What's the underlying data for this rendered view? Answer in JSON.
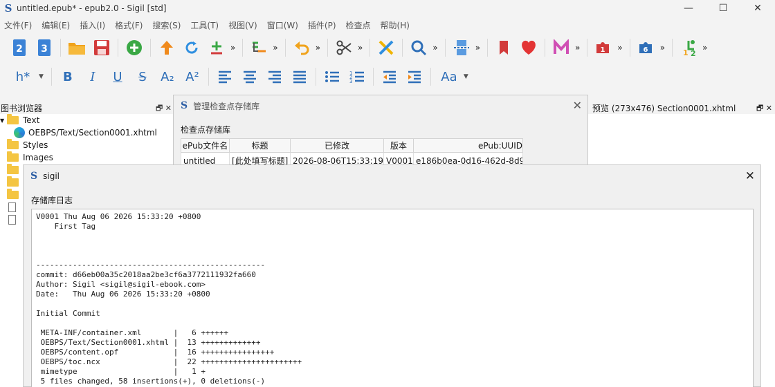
{
  "window": {
    "title": "untitled.epub* - epub2.0 - Sigil [std]",
    "logo": "S",
    "controls": [
      "—",
      "☐",
      "✕"
    ]
  },
  "menu": [
    "文件(F)",
    "编辑(E)",
    "插入(I)",
    "格式(F)",
    "搜索(S)",
    "工具(T)",
    "视图(V)",
    "窗口(W)",
    "插件(P)",
    "检查点",
    "帮助(H)"
  ],
  "toolbar_more": "»",
  "toolbar2": {
    "heading_label": "h*",
    "bold": "B",
    "italic": "I",
    "underline": "U",
    "strike": "S",
    "subscript": "A₂",
    "superscript": "A²",
    "case_label": "Aa"
  },
  "icons": [
    "book-2-icon",
    "book-3-icon",
    "open-folder-icon",
    "save-icon",
    "add-circle-icon",
    "up-arrow-icon",
    "refresh-icon",
    "add-plus-icon",
    "insert-icon",
    "undo-icon",
    "scissors-icon",
    "x-logo-icon",
    "search-icon",
    "split-icon",
    "bookmark-icon",
    "heart-icon",
    "m-logo-icon",
    "plugin-1-icon",
    "plugin-6-icon",
    "plugin-1-2-icon"
  ],
  "colors": {
    "accent_blue": "#2f6fb8",
    "orange": "#f08a1c",
    "red": "#d23b3b",
    "green": "#3aa845",
    "pink": "#d04fb4",
    "folder": "#f4c542"
  },
  "book_browser": {
    "title": "图书浏览器",
    "dock_controls": "🗗  ✕",
    "items": [
      {
        "label": "Text",
        "type": "folder-open"
      },
      {
        "label": "OEBPS/Text/Section0001.xhtml",
        "type": "xhtml"
      },
      {
        "label": "Styles",
        "type": "folder"
      },
      {
        "label": "Images",
        "type": "folder"
      },
      {
        "label": "",
        "type": "folder"
      },
      {
        "label": "",
        "type": "folder"
      },
      {
        "label": "",
        "type": "folder"
      },
      {
        "label": "",
        "type": "file"
      },
      {
        "label": "",
        "type": "file"
      }
    ]
  },
  "preview": {
    "title": "预览 (273x476) Section0001.xhtml",
    "dock_controls": "🗗  ✕"
  },
  "checkpoint_dialog": {
    "title": "管理检查点存储库",
    "label": "检查点存储库",
    "columns": [
      "ePub文件名",
      "标题",
      "已修改",
      "版本",
      "ePub:UUID"
    ],
    "rows": [
      [
        "untitled",
        "[此处填写标题]",
        "2026-08-06T15:33:19Z",
        "V0001",
        "e186b0ea-0d16-462d-8d9"
      ]
    ]
  },
  "log_dialog": {
    "title": "sigil",
    "label": "存储库日志",
    "log": "V0001 Thu Aug 06 2026 15:33:20 +0800\n    First Tag\n\n\n\n--------------------------------------------------\ncommit: d66eb00a35c2018aa2be3cf6a3772111932fa660\nAuthor: Sigil <sigil@sigil-ebook.com>\nDate:   Thu Aug 06 2026 15:33:20 +0800\n\nInitial Commit\n\n META-INF/container.xml       |   6 ++++++\n OEBPS/Text/Section0001.xhtml |  13 +++++++++++++\n OEBPS/content.opf            |  16 ++++++++++++++++\n OEBPS/toc.ncx                |  22 ++++++++++++++++++++++\n mimetype                     |   1 +\n 5 files changed, 58 insertions(+), 0 deletions(-)"
  }
}
